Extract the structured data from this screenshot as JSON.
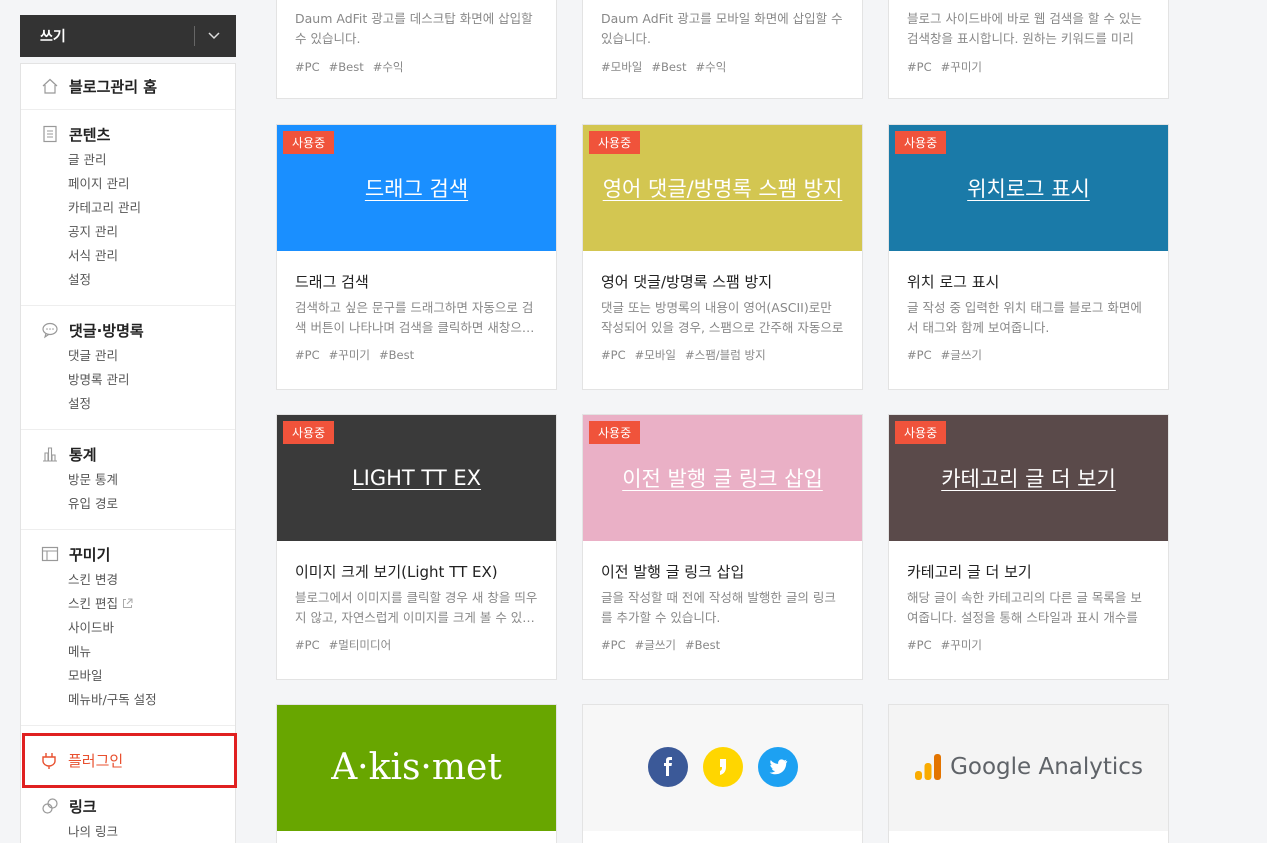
{
  "write_button": {
    "label": "쓰기"
  },
  "sidebar": {
    "home": {
      "label": "블로그관리 홈"
    },
    "sections": [
      {
        "label": "콘텐츠",
        "items": [
          "글 관리",
          "페이지 관리",
          "카테고리 관리",
          "공지 관리",
          "서식 관리",
          "설정"
        ]
      },
      {
        "label": "댓글·방명록",
        "items": [
          "댓글 관리",
          "방명록 관리",
          "설정"
        ]
      },
      {
        "label": "통계",
        "items": [
          "방문 통계",
          "유입 경로"
        ]
      },
      {
        "label": "꾸미기",
        "items": [
          "스킨 변경",
          "스킨 편집",
          "사이드바",
          "메뉴",
          "모바일",
          "메뉴바/구독 설정"
        ]
      }
    ],
    "plugin": {
      "label": "플러그인"
    },
    "link": {
      "label": "링크",
      "items": [
        "나의 링크"
      ]
    }
  },
  "top_cards": [
    {
      "desc": "Daum AdFit 광고를 데스크탑 화면에 삽입할 수 있습니다.",
      "tags": [
        "#PC",
        "#Best",
        "#수익"
      ]
    },
    {
      "desc": "Daum AdFit 광고를 모바일 화면에 삽입할 수 있습니다.",
      "tags": [
        "#모바일",
        "#Best",
        "#수익"
      ]
    },
    {
      "desc": "블로그 사이드바에 바로 웹 검색을 할 수 있는 검색창을 표시합니다. 원하는 키워드를 미리 …",
      "tags": [
        "#PC",
        "#꾸미기"
      ]
    }
  ],
  "cards": [
    {
      "badge": "사용중",
      "thumb_title": "드래그 검색",
      "name": "드래그 검색",
      "desc": "검색하고 싶은 문구를 드래그하면 자동으로 검색 버튼이 나타나며 검색을 클릭하면 새창으…",
      "tags": [
        "#PC",
        "#꾸미기",
        "#Best"
      ],
      "color": "#1a8fff"
    },
    {
      "badge": "사용중",
      "thumb_title": "영어 댓글/방명록 스팸 방지",
      "name": "영어 댓글/방명록 스팸 방지",
      "desc": "댓글 또는 방명록의 내용이 영어(ASCII)로만 작성되어 있을 경우, 스팸으로 간주해 자동으로 …",
      "tags": [
        "#PC",
        "#모바일",
        "#스팸/블럼 방지"
      ],
      "color": "#d3c651"
    },
    {
      "badge": "사용중",
      "thumb_title": "위치로그 표시",
      "name": "위치 로그 표시",
      "desc": "글 작성 중 입력한 위치 태그를 블로그 화면에서 태그와 함께 보여줍니다.",
      "tags": [
        "#PC",
        "#글쓰기"
      ],
      "color": "#1a7aa8"
    },
    {
      "badge": "사용중",
      "thumb_title": "LIGHT TT EX",
      "name": "이미지 크게 보기(Light TT EX)",
      "desc": "블로그에서 이미지를 클릭할 경우 새 창을 띄우지 않고, 자연스럽게 이미지를 크게 볼 수 있…",
      "tags": [
        "#PC",
        "#멀티미디어"
      ],
      "color": "#3a3a3a"
    },
    {
      "badge": "사용중",
      "thumb_title": "이전 발행 글 링크 삽입",
      "name": "이전 발행 글 링크 삽입",
      "desc": "글을 작성할 때 전에 작성해 발행한 글의 링크를 추가할 수 있습니다.",
      "tags": [
        "#PC",
        "#글쓰기",
        "#Best"
      ],
      "color": "#eab0c6"
    },
    {
      "badge": "사용중",
      "thumb_title": "카테고리 글 더 보기",
      "name": "카테고리 글 더 보기",
      "desc": "해당 글이 속한 카테고리의 다른 글 목록을 보여줍니다. 설정을 통해 스타일과 표시 개수를 변…",
      "tags": [
        "#PC",
        "#꾸미기"
      ],
      "color": "#5a4a4a"
    }
  ],
  "bottom": {
    "akismet": {
      "label": "A·kis·met",
      "color": "#68a600"
    },
    "social": {
      "color": "#f7f7f7"
    },
    "ga": {
      "label": "Google Analytics",
      "color": "#f4f4f4"
    }
  }
}
